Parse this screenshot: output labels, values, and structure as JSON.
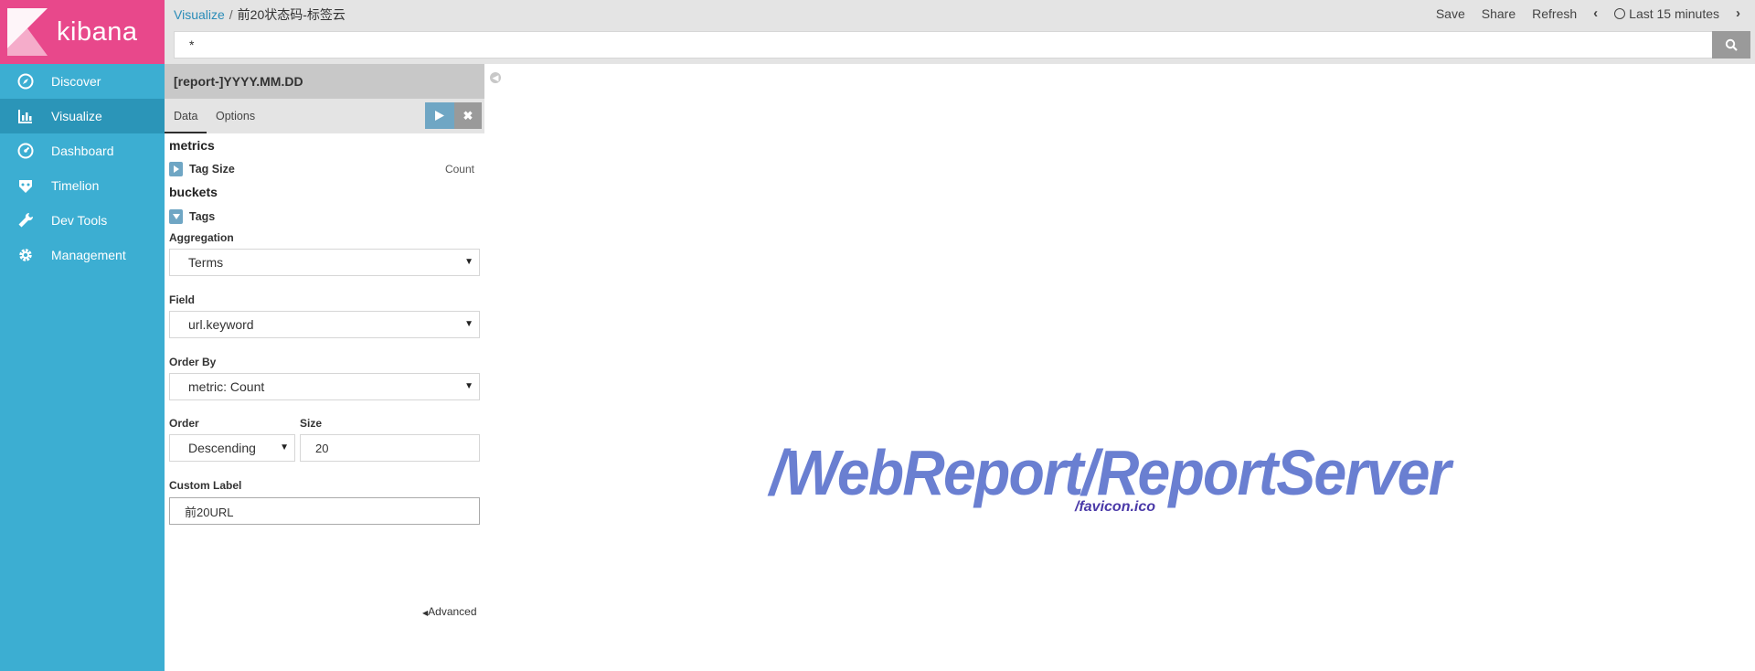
{
  "app": {
    "logo_text": "kibana",
    "brand_color": "#e8488b",
    "sidebar_color": "#3caed2"
  },
  "sidebar": {
    "items": [
      {
        "label": "Discover",
        "icon": "compass-icon",
        "active": false
      },
      {
        "label": "Visualize",
        "icon": "bar-chart-icon",
        "active": true
      },
      {
        "label": "Dashboard",
        "icon": "dashboard-gauge-icon",
        "active": false
      },
      {
        "label": "Timelion",
        "icon": "timelion-shield-icon",
        "active": false
      },
      {
        "label": "Dev Tools",
        "icon": "wrench-icon",
        "active": false
      },
      {
        "label": "Management",
        "icon": "gear-icon",
        "active": false
      }
    ]
  },
  "header": {
    "breadcrumb_link": "Visualize",
    "breadcrumb_sep": "/",
    "breadcrumb_current": "前20状态码-标签云",
    "save_label": "Save",
    "share_label": "Share",
    "refresh_label": "Refresh",
    "time_range_label": "Last 15 minutes",
    "query_value": "*"
  },
  "editor": {
    "index_pattern": "[report-]YYYY.MM.DD",
    "tabs": [
      {
        "label": "Data",
        "active": true
      },
      {
        "label": "Options",
        "active": false
      }
    ],
    "metrics_title": "metrics",
    "metric_agg_label": "Tag Size",
    "metric_agg_value": "Count",
    "buckets_title": "buckets",
    "bucket_agg_label": "Tags",
    "aggregation_label": "Aggregation",
    "aggregation_value": "Terms",
    "field_label": "Field",
    "field_value": "url.keyword",
    "order_by_label": "Order By",
    "order_by_value": "metric: Count",
    "order_label": "Order",
    "order_value": "Descending",
    "size_label": "Size",
    "size_value": "20",
    "custom_label_label": "Custom Label",
    "custom_label_value": "前20URL",
    "advanced_label": "Advanced"
  },
  "tag_cloud": {
    "tags": [
      {
        "text": "/WebReport/ReportServer",
        "color": "#6a7fd1"
      },
      {
        "text": "/favicon.ico",
        "color": "#4a39a8"
      }
    ]
  }
}
